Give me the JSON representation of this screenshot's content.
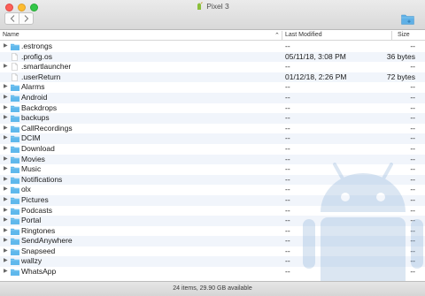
{
  "window": {
    "title": "Pixel 3"
  },
  "columns": {
    "name": "Name",
    "modified": "Last Modified",
    "size": "Size"
  },
  "rows": [
    {
      "name": ".estrongs",
      "modified": "--",
      "size": "--",
      "kind": "folder"
    },
    {
      "name": ".profig.os",
      "modified": "05/11/18, 3:08 PM",
      "size": "36 bytes",
      "kind": "file"
    },
    {
      "name": ".smartlauncher",
      "modified": "--",
      "size": "--",
      "kind": "file-disclosure"
    },
    {
      "name": ".userReturn",
      "modified": "01/12/18, 2:26 PM",
      "size": "72 bytes",
      "kind": "file"
    },
    {
      "name": "Alarms",
      "modified": "--",
      "size": "--",
      "kind": "folder"
    },
    {
      "name": "Android",
      "modified": "--",
      "size": "--",
      "kind": "folder"
    },
    {
      "name": "Backdrops",
      "modified": "--",
      "size": "--",
      "kind": "folder"
    },
    {
      "name": "backups",
      "modified": "--",
      "size": "--",
      "kind": "folder"
    },
    {
      "name": "CallRecordings",
      "modified": "--",
      "size": "--",
      "kind": "folder"
    },
    {
      "name": "DCIM",
      "modified": "--",
      "size": "--",
      "kind": "folder"
    },
    {
      "name": "Download",
      "modified": "--",
      "size": "--",
      "kind": "folder"
    },
    {
      "name": "Movies",
      "modified": "--",
      "size": "--",
      "kind": "folder"
    },
    {
      "name": "Music",
      "modified": "--",
      "size": "--",
      "kind": "folder"
    },
    {
      "name": "Notifications",
      "modified": "--",
      "size": "--",
      "kind": "folder"
    },
    {
      "name": "olx",
      "modified": "--",
      "size": "--",
      "kind": "folder"
    },
    {
      "name": "Pictures",
      "modified": "--",
      "size": "--",
      "kind": "folder"
    },
    {
      "name": "Podcasts",
      "modified": "--",
      "size": "--",
      "kind": "folder"
    },
    {
      "name": "Portal",
      "modified": "--",
      "size": "--",
      "kind": "folder"
    },
    {
      "name": "Ringtones",
      "modified": "--",
      "size": "--",
      "kind": "folder"
    },
    {
      "name": "SendAnywhere",
      "modified": "--",
      "size": "--",
      "kind": "folder"
    },
    {
      "name": "Snapseed",
      "modified": "--",
      "size": "--",
      "kind": "folder"
    },
    {
      "name": "wallzy",
      "modified": "--",
      "size": "--",
      "kind": "folder"
    },
    {
      "name": "WhatsApp",
      "modified": "--",
      "size": "--",
      "kind": "folder"
    }
  ],
  "status": "24 items, 29.90 GB available",
  "colors": {
    "folder": "#5fb8ec",
    "android_watermark": "#7fa8d4"
  }
}
